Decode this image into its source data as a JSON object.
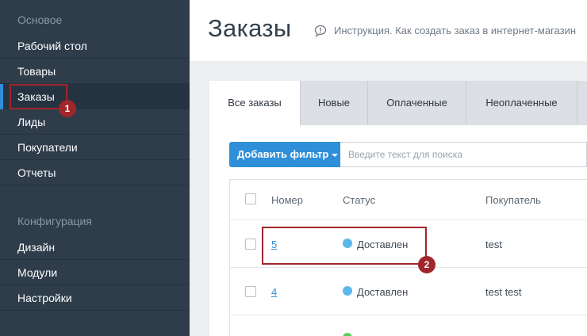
{
  "sidebar": {
    "section_main": "Основое",
    "main_items": [
      "Рабочий стол",
      "Товары",
      "Заказы",
      "Лиды",
      "Покупатели",
      "Отчеты"
    ],
    "section_config": "Конфигурация",
    "config_items": [
      "Дизайн",
      "Модули",
      "Настройки"
    ],
    "active_item": "Заказы"
  },
  "header": {
    "title": "Заказы",
    "help_icon": "comment-icon",
    "help_text": "Инструкция. Как создать заказ в интернет-магазин"
  },
  "tabs": [
    "Все заказы",
    "Новые",
    "Оплаченные",
    "Неоплаченные"
  ],
  "filter": {
    "button_label": "Добавить фильтр",
    "search_placeholder": "Введите текст для поиска"
  },
  "table": {
    "columns": [
      "Номер",
      "Статус",
      "Покупатель"
    ],
    "rows": [
      {
        "number": "5",
        "status": "Доставлен",
        "buyer": "test",
        "status_color": "#5ab8ea"
      },
      {
        "number": "4",
        "status": "Доставлен",
        "buyer": "test test",
        "status_color": "#5ab8ea"
      },
      {
        "number": "",
        "status": "",
        "buyer": "",
        "status_color": "#5cd05c"
      }
    ]
  },
  "annotations": [
    "1",
    "2"
  ],
  "colors": {
    "sidebar_bg": "#2f3d4b",
    "accent": "#2f8fd8",
    "annotation": "#a0262b"
  }
}
